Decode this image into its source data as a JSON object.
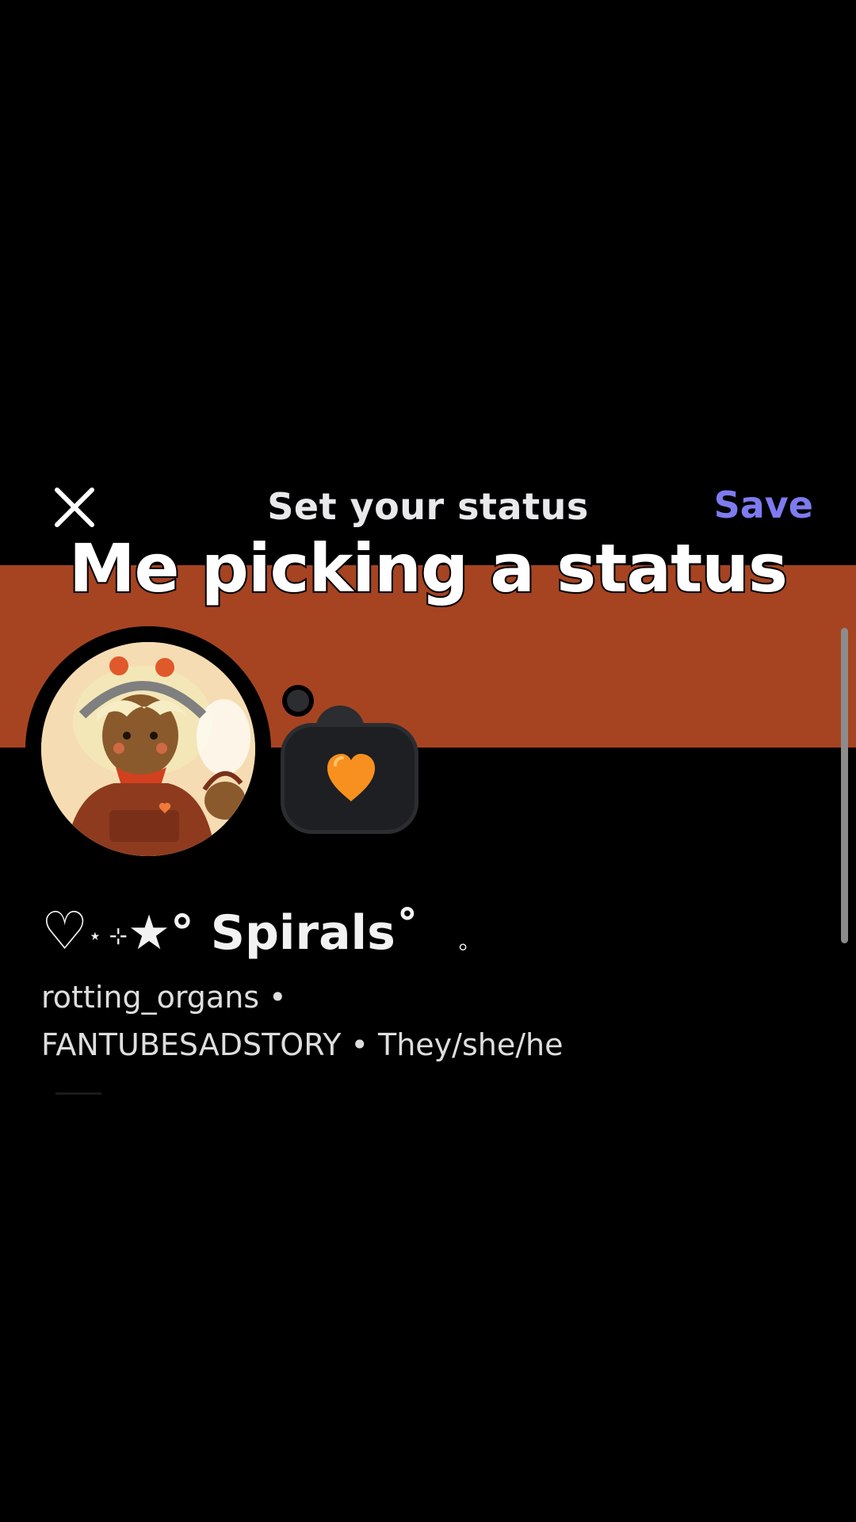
{
  "header": {
    "title": "Set your status",
    "save_label": "Save",
    "close_icon": "close-icon"
  },
  "caption": "Me picking a status",
  "colors": {
    "banner": "#a64422",
    "save": "#7e7bf0",
    "background": "#000000"
  },
  "status": {
    "emoji": "orange-heart"
  },
  "profile": {
    "display_name_prefix": "♡",
    "display_name_deco": "⋆ ⊹",
    "display_name_star": "★°",
    "display_name": "Spirals",
    "display_name_suffix": "˚",
    "display_name_trail": "｡",
    "username_line": "rotting_organs •",
    "tag_line": "FANTUBESADSTORY • They/she/he"
  }
}
